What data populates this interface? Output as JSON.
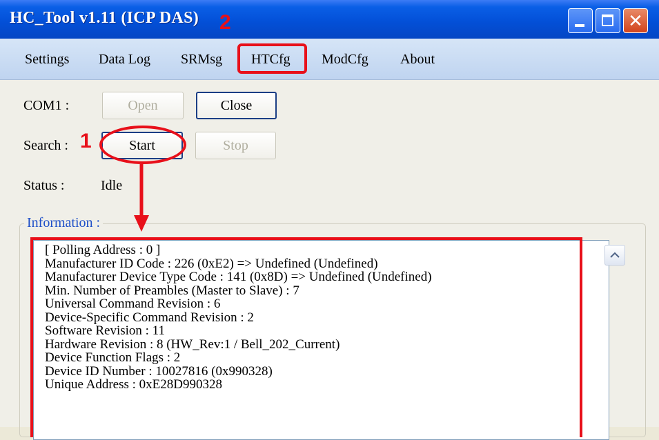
{
  "window": {
    "title": "HC_Tool v1.11  (ICP DAS)"
  },
  "menu": {
    "items": [
      {
        "label": "Settings"
      },
      {
        "label": "Data Log"
      },
      {
        "label": "SRMsg"
      },
      {
        "label": "HTCfg"
      },
      {
        "label": "ModCfg"
      },
      {
        "label": "About"
      }
    ]
  },
  "com": {
    "port_label": "COM1  :",
    "open_label": "Open",
    "close_label": "Close"
  },
  "search": {
    "label": "Search :",
    "start_label": "Start",
    "stop_label": "Stop"
  },
  "status": {
    "label": "Status  :",
    "value": "Idle"
  },
  "information": {
    "legend": "Information :",
    "lines": [
      "[  Polling Address : 0  ]",
      "Manufacturer ID Code : 226 (0xE2) => Undefined (Undefined)",
      "Manufacturer Device Type Code : 141 (0x8D) => Undefined (Undefined)",
      "Min. Number of Preambles (Master to Slave) : 7",
      "Universal Command Revision : 6",
      "Device-Specific Command Revision : 2",
      "Software Revision : 11",
      "Hardware Revision : 8 (HW_Rev:1 / Bell_202_Current)",
      "Device Function Flags : 2",
      "Device ID Number : 10027816 (0x990328)",
      "Unique Address : 0xE28D990328"
    ]
  },
  "annotations": {
    "step1": "1",
    "step2": "2",
    "color": "#e8101a"
  },
  "icons": {
    "minimize": "minimize-icon",
    "maximize": "maximize-icon",
    "close": "close-icon",
    "scroll_up": "chevron-up-icon"
  }
}
